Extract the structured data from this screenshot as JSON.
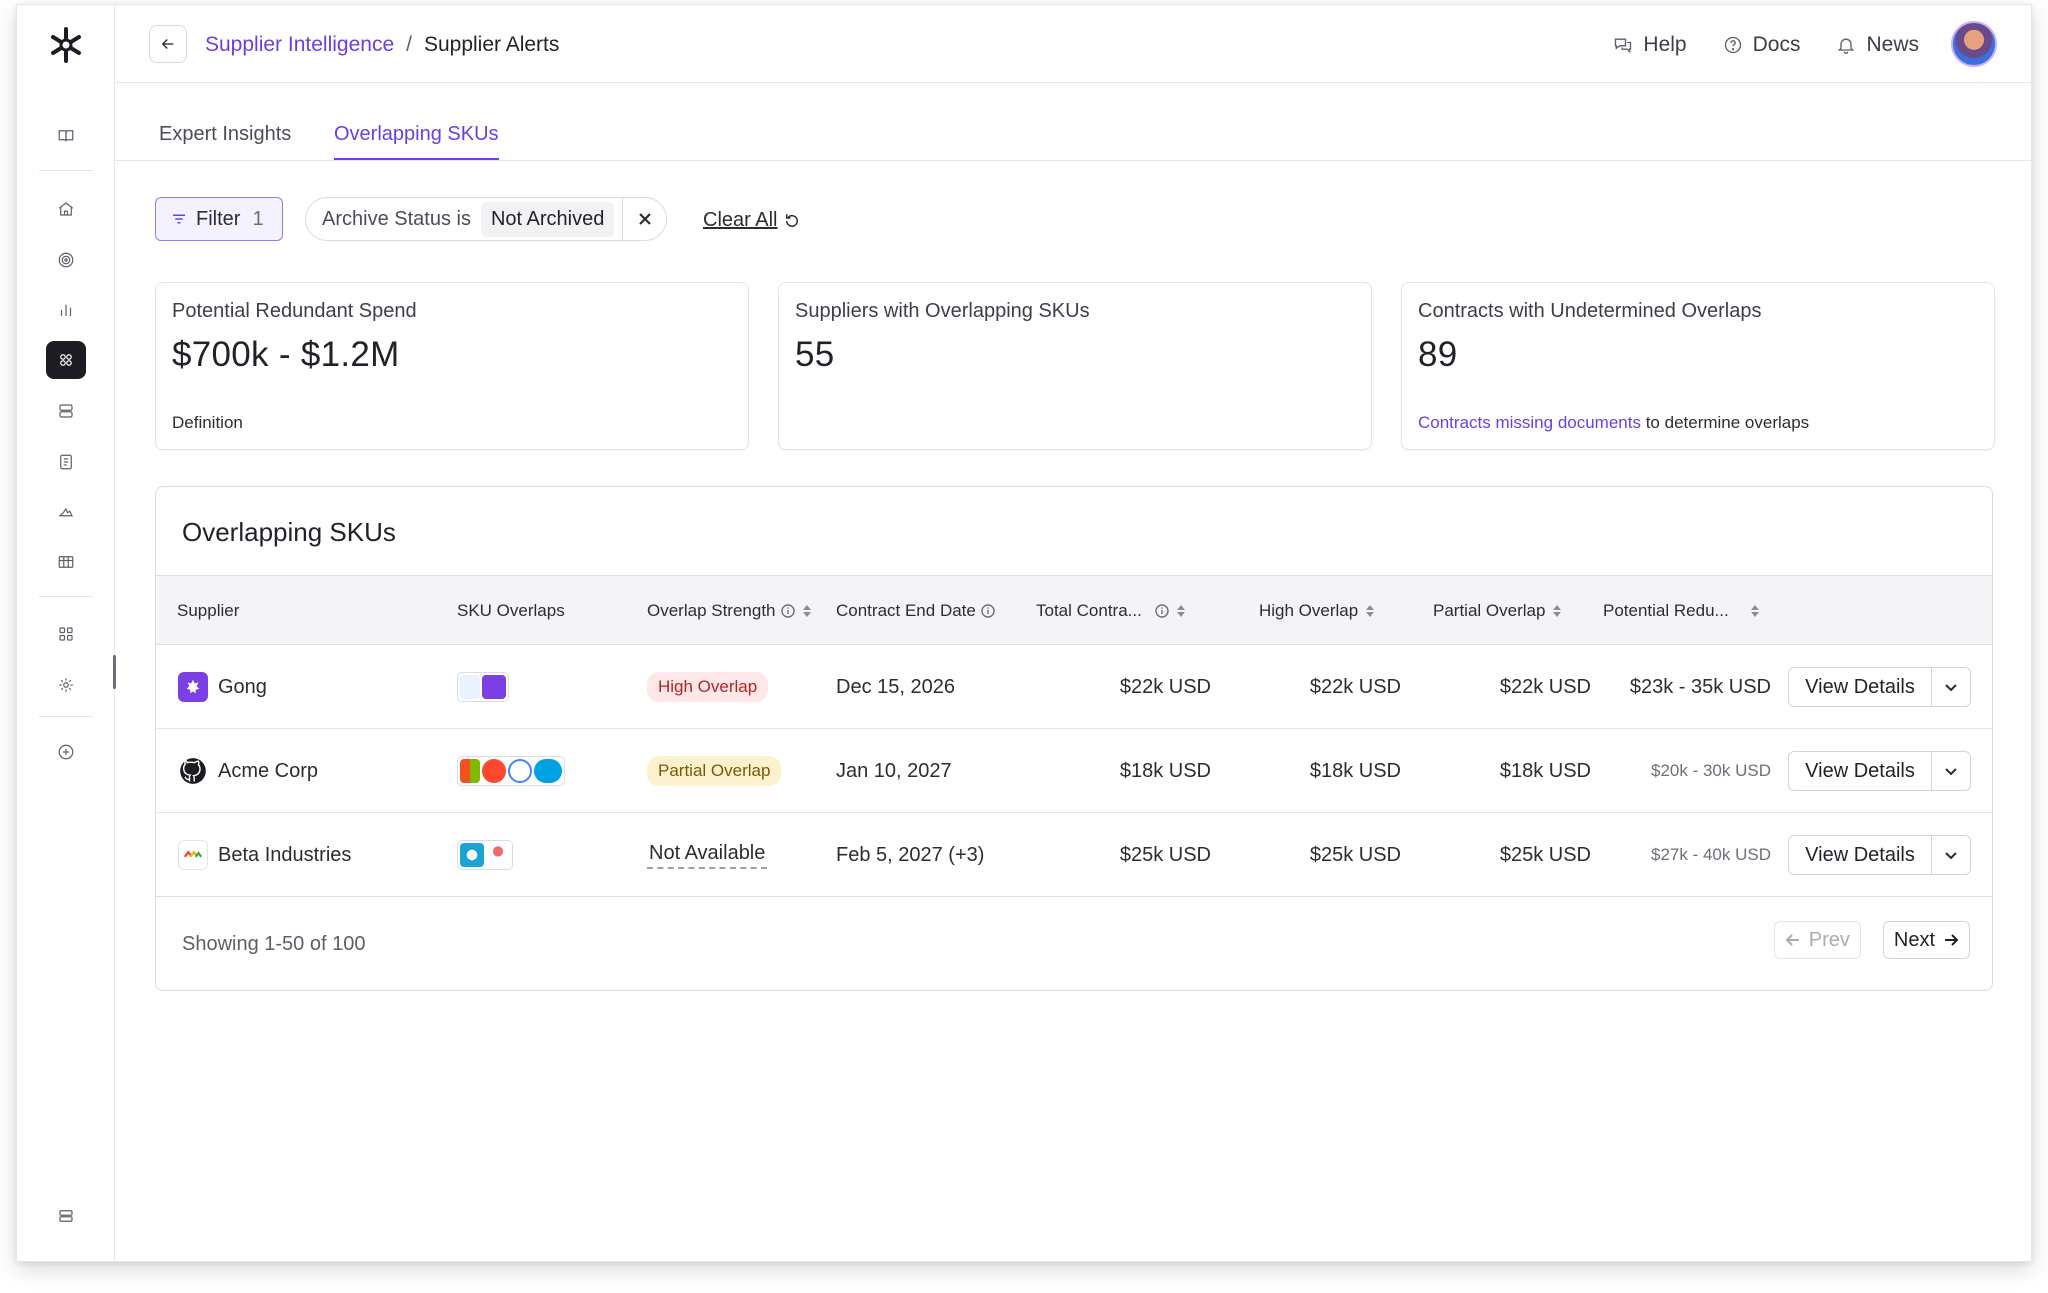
{
  "topbar": {
    "breadcrumb": {
      "parent": "Supplier Intelligence",
      "separator": "/",
      "current": "Supplier Alerts"
    },
    "actions": [
      {
        "label": "Help",
        "icon": "chat-bubbles-icon"
      },
      {
        "label": "Docs",
        "icon": "question-circle-icon"
      },
      {
        "label": "News",
        "icon": "bell-icon"
      }
    ]
  },
  "tabs": [
    {
      "label": "Expert Insights",
      "active": false
    },
    {
      "label": "Overlapping SKUs",
      "active": true
    }
  ],
  "filters": {
    "filter_button": {
      "label": "Filter",
      "count": "1"
    },
    "chip": {
      "field": "Archive Status is",
      "value": "Not Archived"
    },
    "clear_all": "Clear All"
  },
  "cards": [
    {
      "label": "Potential Redundant Spend",
      "value": "$700k - $1.2M",
      "footer_link": "",
      "footer_text": "Definition"
    },
    {
      "label": "Suppliers with Overlapping SKUs",
      "value": "55",
      "footer_link": "",
      "footer_text": ""
    },
    {
      "label": "Contracts with Undetermined Overlaps",
      "value": "89",
      "footer_link": "Contracts missing documents",
      "footer_text": " to determine overlaps"
    }
  ],
  "table": {
    "title": "Overlapping SKUs",
    "columns": [
      "Supplier",
      "SKU Overlaps",
      "Overlap Strength",
      "Contract End Date",
      "Total Contra...",
      "High Overlap",
      "Partial Overlap",
      "Potential Redu..."
    ],
    "rows": [
      {
        "supplier": "Gong",
        "strength": "High Overlap",
        "end_date": "Dec 15, 2026",
        "total": "$22k USD",
        "high": "$22k USD",
        "partial": "$22k USD",
        "potential": "$23k - 35k USD",
        "action": "View Details"
      },
      {
        "supplier": "Acme Corp",
        "strength": "Partial Overlap",
        "end_date": "Jan 10, 2027",
        "total": "$18k USD",
        "high": "$18k USD",
        "partial": "$18k USD",
        "potential": "$20k - 30k USD",
        "action": "View Details"
      },
      {
        "supplier": "Beta Industries",
        "strength": "Not Available",
        "end_date": "Feb 5, 2027 (+3)",
        "total": "$25k USD",
        "high": "$25k USD",
        "partial": "$25k USD",
        "potential": "$27k - 40k USD",
        "action": "View Details"
      }
    ],
    "footer": {
      "showing": "Showing 1-50 of 100",
      "prev": "Prev",
      "next": "Next"
    }
  },
  "colors": {
    "accent": "#6b3fe0",
    "high_badge_bg": "#fde7e8",
    "partial_badge_bg": "#fdf2cf"
  }
}
